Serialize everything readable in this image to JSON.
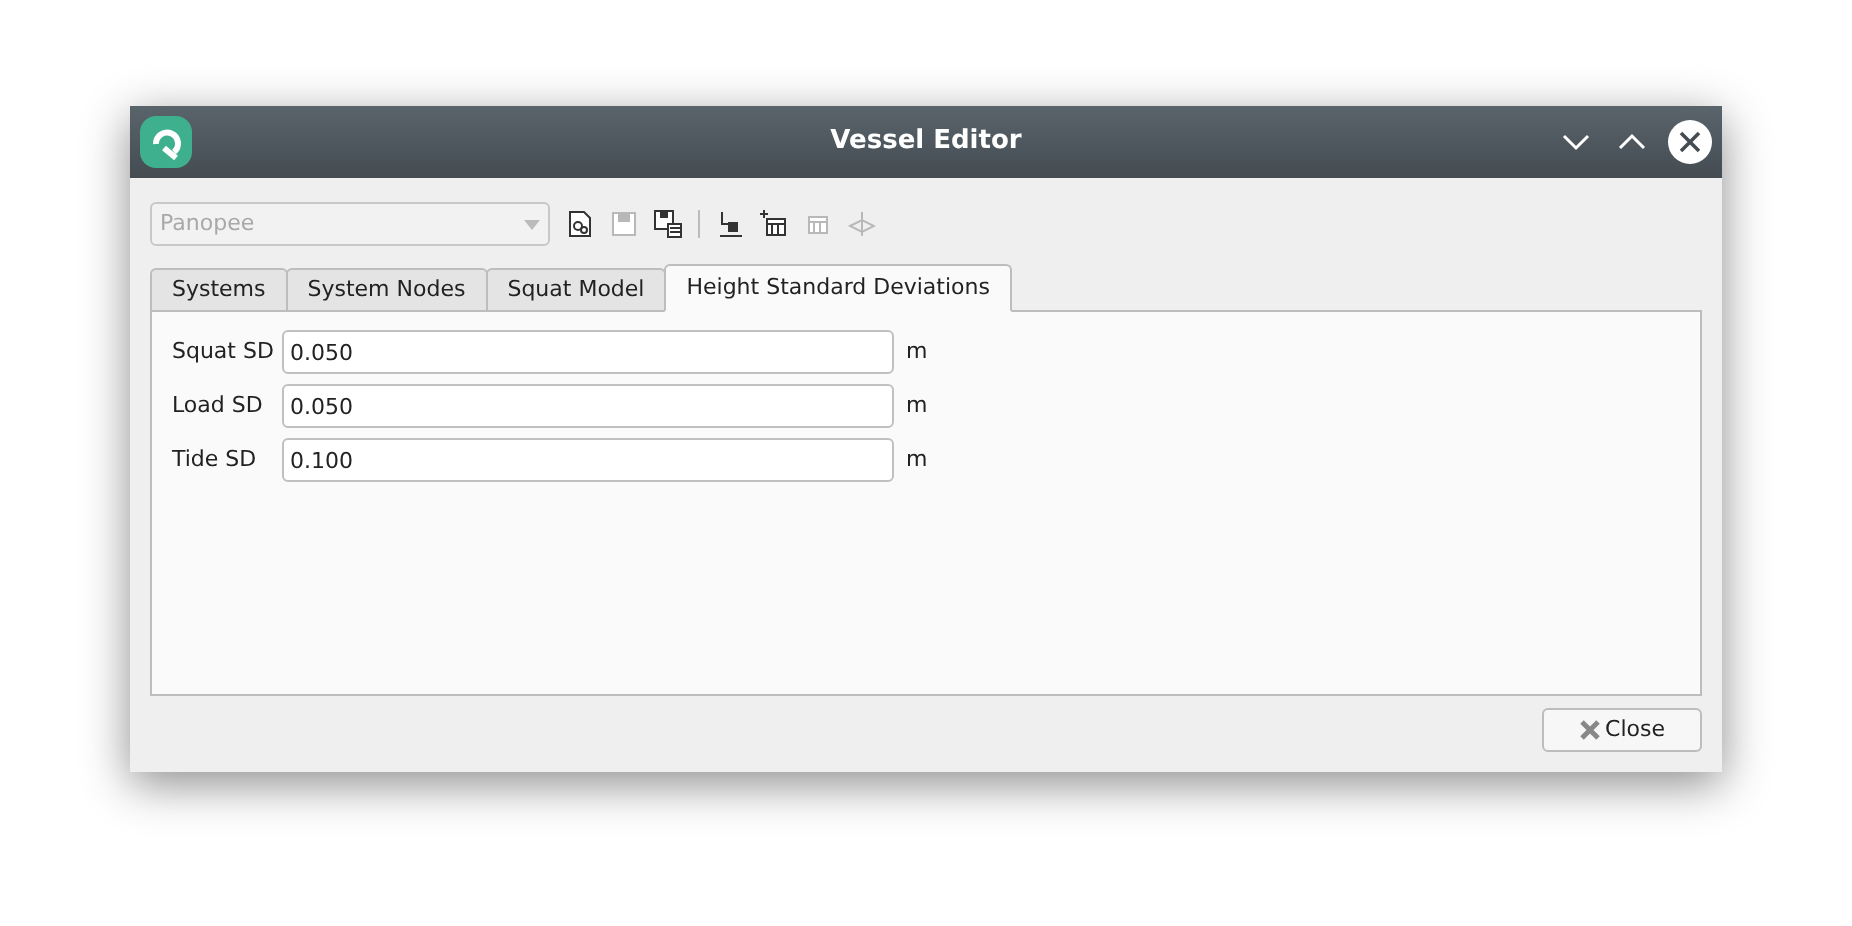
{
  "window": {
    "title": "Vessel Editor"
  },
  "vessel_select": {
    "value": "Panopee",
    "disabled": true
  },
  "toolbar": [
    {
      "kind": "document",
      "disabled": false
    },
    {
      "kind": "save",
      "disabled": true
    },
    {
      "kind": "save-as",
      "disabled": false
    },
    {
      "kind": "separator"
    },
    {
      "kind": "node",
      "disabled": false
    },
    {
      "kind": "add-table",
      "disabled": false
    },
    {
      "kind": "table",
      "disabled": true
    },
    {
      "kind": "axes",
      "disabled": true
    }
  ],
  "tabs": [
    {
      "label": "Systems",
      "selected": false
    },
    {
      "label": "System Nodes",
      "selected": false
    },
    {
      "label": "Squat Model",
      "selected": false
    },
    {
      "label": "Height Standard Deviations",
      "selected": true
    }
  ],
  "fields": [
    {
      "label": "Squat SD",
      "value": "0.050",
      "unit": "m"
    },
    {
      "label": "Load SD",
      "value": "0.050",
      "unit": "m"
    },
    {
      "label": "Tide SD",
      "value": "0.100",
      "unit": "m"
    }
  ],
  "close_button": {
    "label": "Close"
  }
}
